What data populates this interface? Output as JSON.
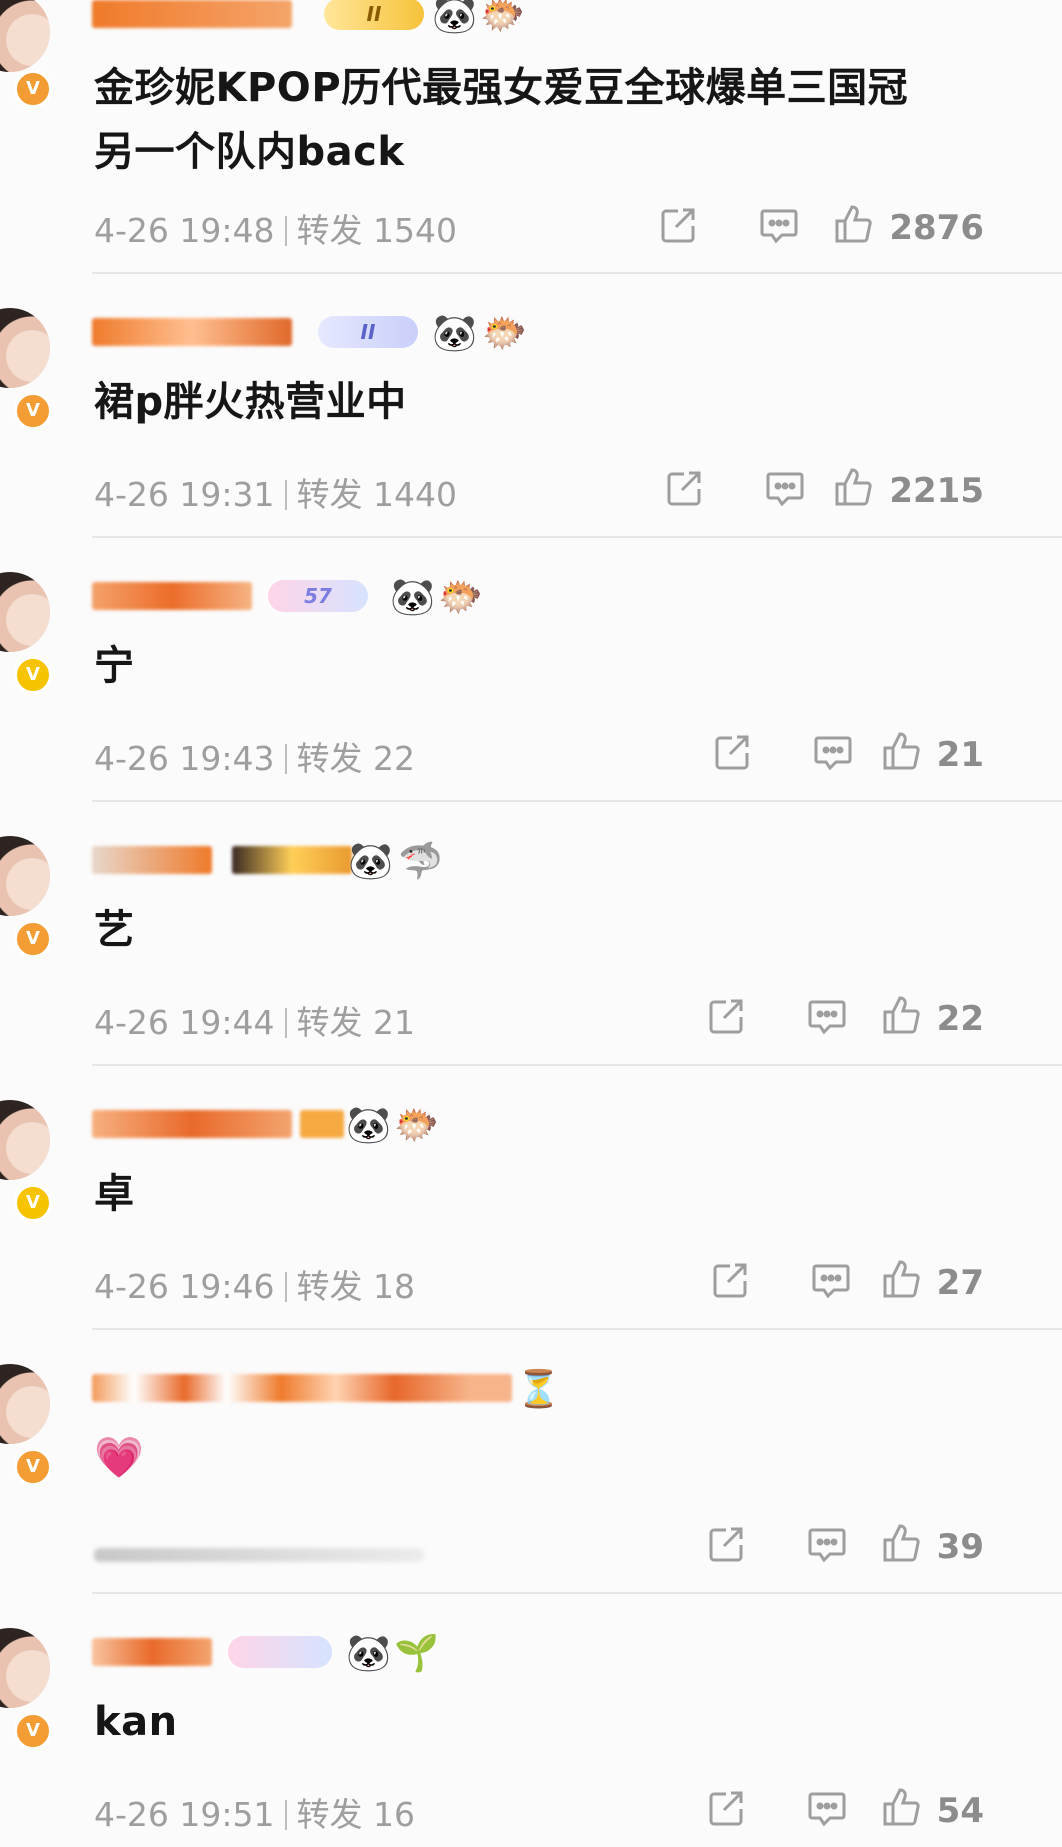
{
  "posts": [
    {
      "content": "金珍妮KPOP历代最强女爱豆全球爆单三国冠\n另一个队内back",
      "time": "4-26 19:48",
      "repost_label": "转发",
      "repost_count": "1540",
      "likes": "2876",
      "badge": "gold",
      "badge_text": "II",
      "emojis": [
        "🐼",
        "🐡"
      ],
      "vbadge": "orange",
      "show_meta": true
    },
    {
      "content": "裙p胖火热营业中",
      "time": "4-26 19:31",
      "repost_label": "转发",
      "repost_count": "1440",
      "likes": "2215",
      "badge": "blue",
      "badge_text": "II",
      "emojis": [
        "🐼",
        "🐡"
      ],
      "vbadge": "orange",
      "show_meta": true
    },
    {
      "content": "宁",
      "time": "4-26 19:43",
      "repost_label": "转发",
      "repost_count": "22",
      "likes": "21",
      "badge": "pink",
      "badge_text": "57",
      "emojis": [
        "🐼",
        "🐡"
      ],
      "vbadge": "yellow",
      "show_meta": true
    },
    {
      "content": "艺",
      "time": "4-26 19:44",
      "repost_label": "转发",
      "repost_count": "21",
      "likes": "22",
      "badge": "gold",
      "badge_text": "",
      "emojis": [
        "🐼",
        "🦈"
      ],
      "vbadge": "orange",
      "show_meta": true
    },
    {
      "content": "卓",
      "time": "4-26 19:46",
      "repost_label": "转发",
      "repost_count": "18",
      "likes": "27",
      "badge": "none",
      "badge_text": "",
      "emojis": [
        "🐼",
        "🐡"
      ],
      "vbadge": "yellow",
      "show_meta": true
    },
    {
      "content": "💗",
      "time": "",
      "repost_label": "",
      "repost_count": "",
      "likes": "39",
      "badge": "none",
      "badge_text": "",
      "emojis": [
        "⏳"
      ],
      "vbadge": "orange",
      "show_meta": false
    },
    {
      "content": "kan",
      "time": "4-26 19:51",
      "repost_label": "转发",
      "repost_count": "16",
      "likes": "54",
      "badge": "pink",
      "badge_text": "",
      "emojis": [
        "🐼",
        "🌱"
      ],
      "vbadge": "orange",
      "show_meta": true
    }
  ]
}
